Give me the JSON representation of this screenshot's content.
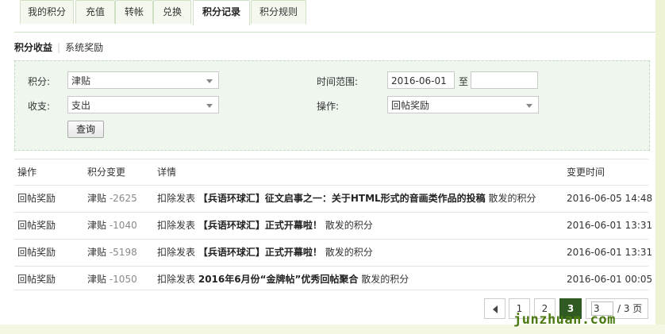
{
  "tabs": [
    {
      "label": "我的积分",
      "active": false
    },
    {
      "label": "充值",
      "active": false
    },
    {
      "label": "转帐",
      "active": false
    },
    {
      "label": "兑换",
      "active": false
    },
    {
      "label": "积分记录",
      "active": true
    },
    {
      "label": "积分规则",
      "active": false
    }
  ],
  "subnav": {
    "income": "积分收益",
    "system_reward": "系统奖励"
  },
  "filter": {
    "credit_label": "积分:",
    "credit_value": "津贴",
    "inout_label": "收支:",
    "inout_value": "支出",
    "range_label": "时间范围:",
    "range_start": "2016-06-01",
    "range_to": "至",
    "range_end": "",
    "op_label": "操作:",
    "op_value": "回帖奖励",
    "query_button": "查询"
  },
  "table": {
    "headers": [
      "操作",
      "积分变更",
      "详情",
      "变更时间"
    ],
    "rows": [
      {
        "op": "回帖奖励",
        "credit": "津贴",
        "amount": "-2625",
        "prefix": "扣除发表",
        "subject": "【兵语环球汇】征文启事之一：关于HTML形式的音画类作品的投稿",
        "suffix": "散发的积分",
        "time": "2016-06-05 14:48"
      },
      {
        "op": "回帖奖励",
        "credit": "津贴",
        "amount": "-1040",
        "prefix": "扣除发表",
        "subject": "【兵语环球汇】正式开幕啦！",
        "suffix": "散发的积分",
        "time": "2016-06-01 13:31"
      },
      {
        "op": "回帖奖励",
        "credit": "津贴",
        "amount": "-5198",
        "prefix": "扣除发表",
        "subject": "【兵语环球汇】正式开幕啦！",
        "suffix": "散发的积分",
        "time": "2016-06-01 13:31"
      },
      {
        "op": "回帖奖励",
        "credit": "津贴",
        "amount": "-1050",
        "prefix": "扣除发表",
        "subject": "2016年6月份“金牌帖”优秀回帖聚合",
        "suffix": "散发的积分",
        "time": "2016-06-01 00:05"
      }
    ]
  },
  "pagination": {
    "pages": [
      "1",
      "2",
      "3"
    ],
    "current": "3",
    "input_value": "3",
    "total": "/ 3 页",
    "prev_icon": "chevron-left-icon"
  },
  "watermark": "junzhuan.com",
  "colors": {
    "accent": "#2f5a22",
    "filter_bg": "#eef6ee",
    "page_bg": "#f3f7e4"
  }
}
